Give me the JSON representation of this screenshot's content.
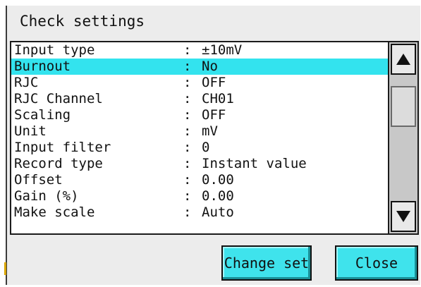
{
  "window": {
    "title": "Check settings"
  },
  "settings": {
    "separator": ":",
    "rows": [
      {
        "key": "Input type",
        "value": "±10mV",
        "selected": false
      },
      {
        "key": "Burnout",
        "value": "No",
        "selected": true
      },
      {
        "key": "RJC",
        "value": "OFF",
        "selected": false
      },
      {
        "key": "RJC Channel",
        "value": "CH01",
        "selected": false
      },
      {
        "key": "Scaling",
        "value": "OFF",
        "selected": false
      },
      {
        "key": "Unit",
        "value": "mV",
        "selected": false
      },
      {
        "key": "Input filter",
        "value": "0",
        "selected": false
      },
      {
        "key": "Record type",
        "value": "Instant value",
        "selected": false
      },
      {
        "key": "Offset",
        "value": "0.00",
        "selected": false
      },
      {
        "key": "Gain (%)",
        "value": "0.00",
        "selected": false
      },
      {
        "key": "Make scale",
        "value": "Auto",
        "selected": false
      }
    ]
  },
  "scrollbar": {
    "up_icon": "triangle-up",
    "down_icon": "triangle-down"
  },
  "buttons": {
    "change_set": "Change set",
    "close": "Close"
  },
  "colors": {
    "highlight": "#33e3ee",
    "button": "#3fe3ec"
  }
}
